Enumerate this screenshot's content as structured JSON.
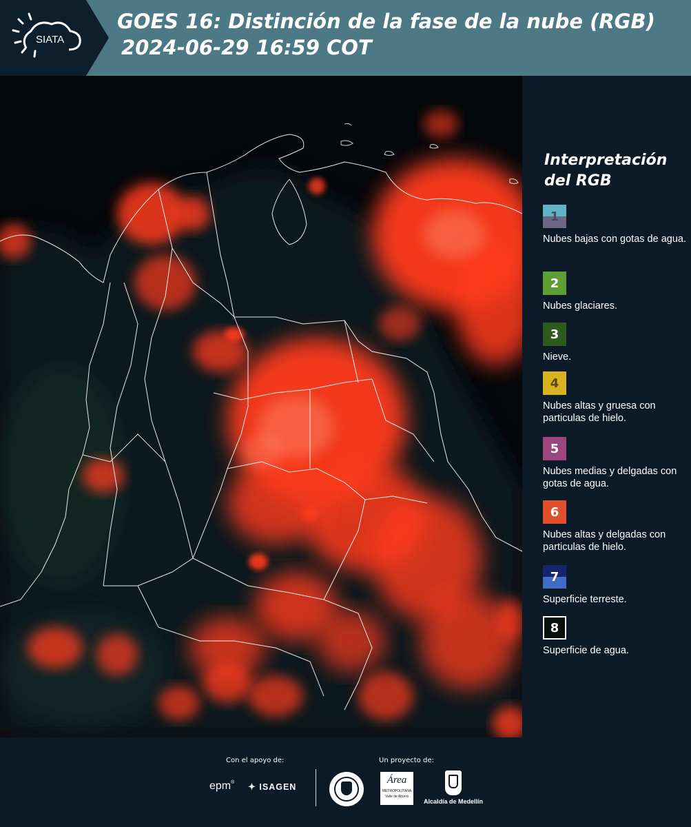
{
  "header": {
    "title_line1": "GOES 16: Distinción de la fase de la nube (RGB)",
    "title_line2": "2024-06-29 16:59 COT",
    "logo_text": "SIATA"
  },
  "legend": {
    "title": "Interpretación del RGB",
    "items": [
      {
        "number": "1",
        "label": "Nubes bajas con gotas de agua.",
        "color_top": "#5fb3c4",
        "color_bottom": "#6b6784"
      },
      {
        "number": "2",
        "label": "Nubes glaciares.",
        "color": "#5e9e34"
      },
      {
        "number": "3",
        "label": "Nieve.",
        "color": "#2d5a1f"
      },
      {
        "number": "4",
        "label": "Nubes altas y gruesa con particulas de hielo.",
        "color": "#d8b21f"
      },
      {
        "number": "5",
        "label": "Nubes medias y delgadas con gotas de agua.",
        "color": "#9b467c"
      },
      {
        "number": "6",
        "label": "Nubes altas y delgadas con particulas de hielo.",
        "color": "#e0502c"
      },
      {
        "number": "7",
        "label": "Superficie terreste.",
        "color_top": "#15256b",
        "color_bottom": "#3f6cc4"
      },
      {
        "number": "8",
        "label": "Superficie de agua.",
        "color": "#05100a"
      }
    ]
  },
  "footer": {
    "support_label": "Con el apoyo de:",
    "project_label": "Un proyecto de:",
    "sponsor1": "epm",
    "sponsor2": "ISAGEN",
    "partner_area_line1": "Área",
    "partner_area_line2": "METROPOLITANA",
    "partner_area_line3": "Valle de Aburrá",
    "partner_alcaldia": "Alcaldía de Medellín"
  }
}
